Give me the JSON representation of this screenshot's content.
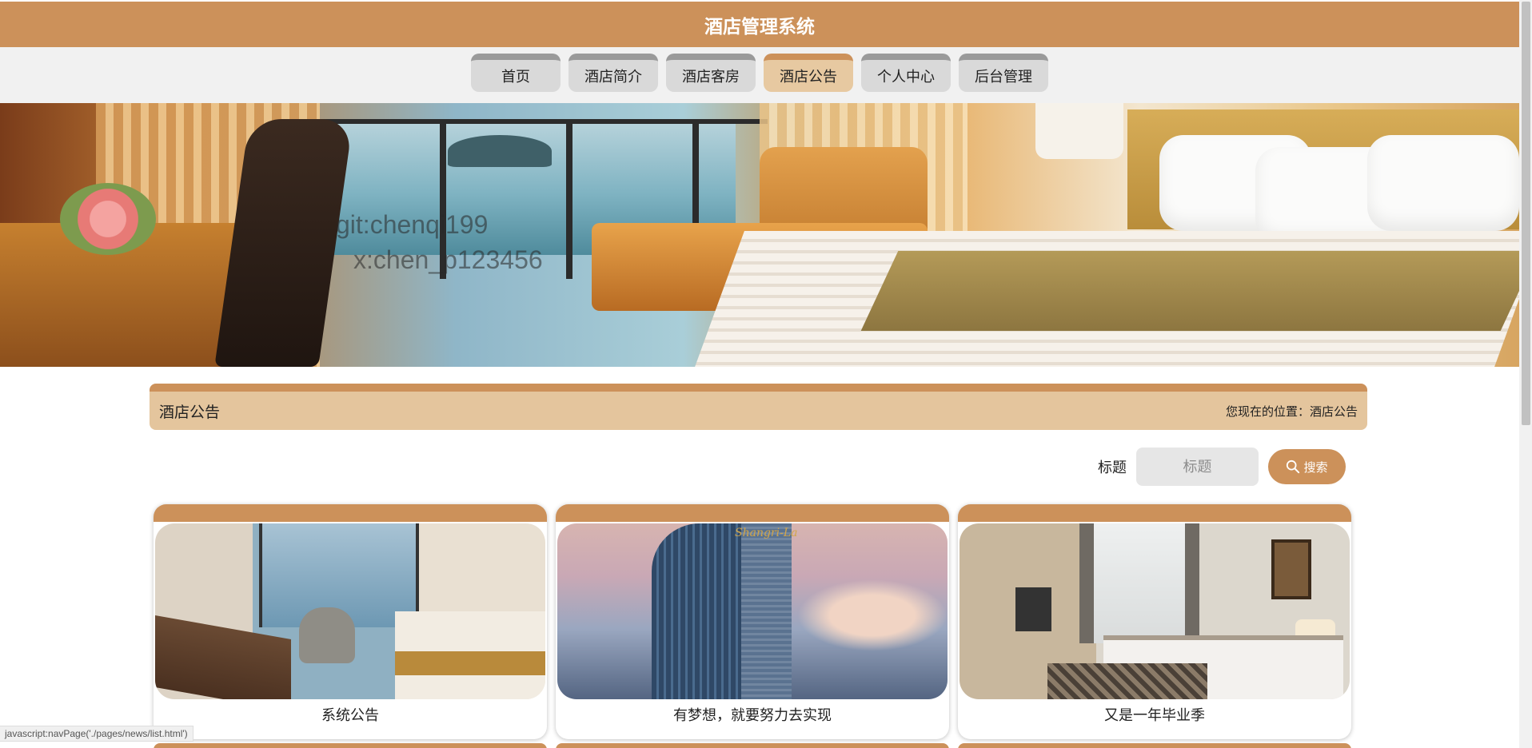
{
  "header": {
    "title": "酒店管理系统"
  },
  "nav": {
    "items": [
      {
        "label": "首页"
      },
      {
        "label": "酒店简介"
      },
      {
        "label": "酒店客房"
      },
      {
        "label": "酒店公告"
      },
      {
        "label": "个人中心"
      },
      {
        "label": "后台管理"
      }
    ],
    "active_index": 3
  },
  "banner": {
    "watermark_line1": "git:chenqi199",
    "watermark_line2": "x:chen_p123456"
  },
  "section": {
    "title": "酒店公告",
    "breadcrumb_prefix": "您现在的位置：",
    "breadcrumb_current": "酒店公告"
  },
  "search": {
    "label": "标题",
    "placeholder": "标题",
    "value": "",
    "button_label": "搜索",
    "button_icon": "search-icon"
  },
  "cards": [
    {
      "title": "系统公告"
    },
    {
      "title": "有梦想，就要努力去实现",
      "image_sign": "Shangri-La"
    },
    {
      "title": "又是一年毕业季"
    }
  ],
  "statusbar": {
    "text": "javascript:navPage('./pages/news/list.html')"
  },
  "colors": {
    "accent": "#cc915a",
    "accent_light": "#e4c59d",
    "nav_bg": "#f1f1f1",
    "nav_item": "#d9d9d9"
  }
}
